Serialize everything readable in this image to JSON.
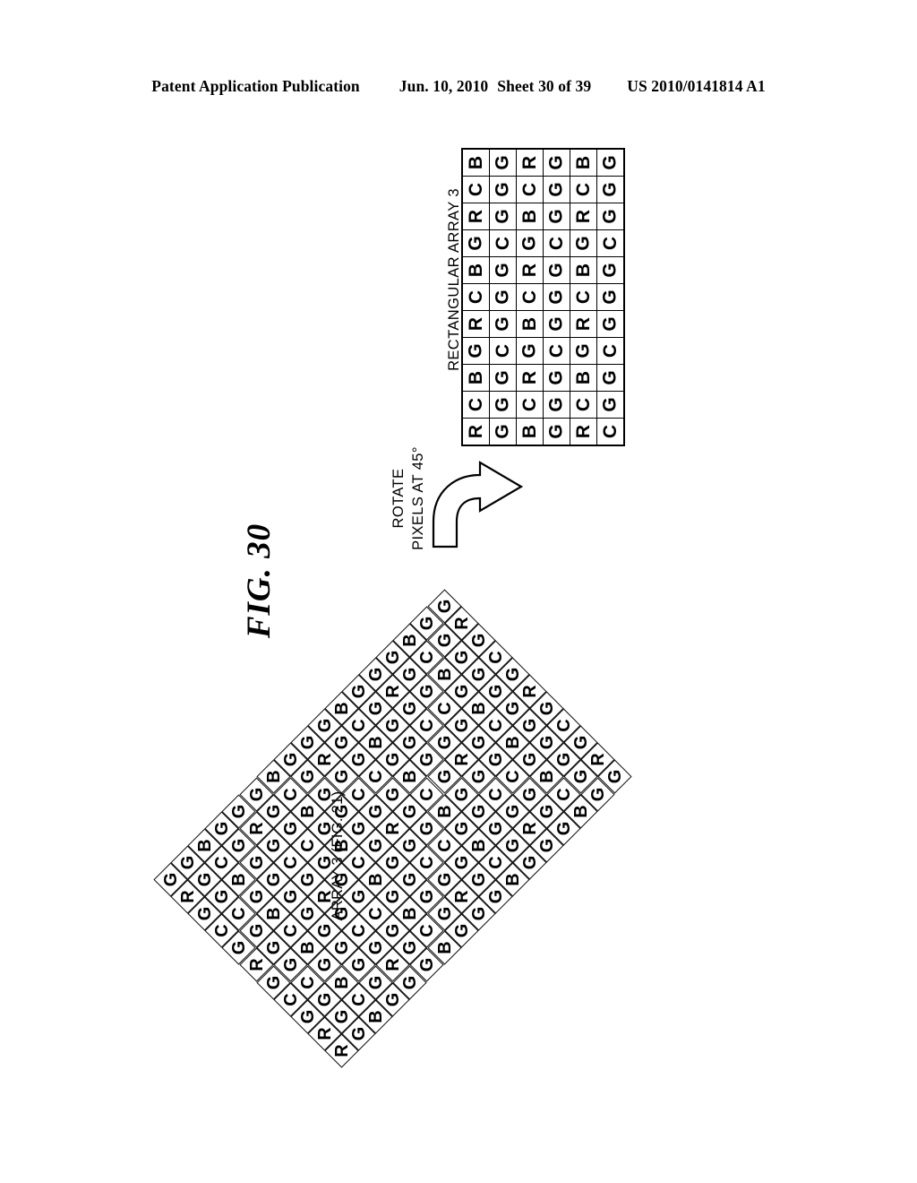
{
  "header": {
    "publication": "Patent Application Publication",
    "date": "Jun. 10, 2010",
    "sheet": "Sheet 30 of 39",
    "docnum": "US 2010/0141814 A1"
  },
  "figure": {
    "title": "FIG. 30"
  },
  "rotate_note": {
    "line1": "ROTATE",
    "line2": "PIXELS AT 45°",
    "arrow_icon": "curved-arrow-right-icon"
  },
  "rectangular_array": {
    "label": "RECTANGULAR ARRAY 3",
    "columns": 6,
    "rows": 11,
    "grid": [
      [
        "B",
        "G",
        "R",
        "G",
        "B",
        "G"
      ],
      [
        "C",
        "G",
        "C",
        "G",
        "C",
        "G"
      ],
      [
        "R",
        "G",
        "B",
        "G",
        "R",
        "G"
      ],
      [
        "G",
        "C",
        "G",
        "C",
        "G",
        "C"
      ],
      [
        "B",
        "G",
        "R",
        "G",
        "B",
        "G"
      ],
      [
        "C",
        "G",
        "C",
        "G",
        "C",
        "G"
      ],
      [
        "R",
        "G",
        "B",
        "G",
        "R",
        "G"
      ],
      [
        "G",
        "C",
        "G",
        "C",
        "G",
        "C"
      ],
      [
        "B",
        "G",
        "R",
        "G",
        "B",
        "G"
      ],
      [
        "C",
        "G",
        "C",
        "G",
        "C",
        "G"
      ],
      [
        "R",
        "G",
        "B",
        "G",
        "R",
        "C"
      ]
    ]
  },
  "diamond_array": {
    "label": "ARRAY 3 (FIG. 21)",
    "rotation_degrees": 45,
    "columns": 11,
    "rows": 17,
    "grid": [
      [
        "G",
        "R",
        "G",
        "C",
        "G",
        "R",
        "G",
        "C",
        "G",
        "R",
        "G"
      ],
      [
        "G",
        "G",
        "G",
        "G",
        "G",
        "G",
        "G",
        "G",
        "G",
        "G",
        "G"
      ],
      [
        "B",
        "C",
        "B",
        "G",
        "B",
        "C",
        "B",
        "G",
        "B",
        "C",
        "B"
      ],
      [
        "G",
        "G",
        "G",
        "C",
        "G",
        "G",
        "G",
        "C",
        "G",
        "G",
        "G"
      ],
      [
        "G",
        "R",
        "G",
        "C",
        "G",
        "R",
        "G",
        "C",
        "G",
        "R",
        "G"
      ],
      [
        "G",
        "G",
        "G",
        "G",
        "G",
        "G",
        "G",
        "G",
        "G",
        "G",
        "G"
      ],
      [
        "B",
        "C",
        "B",
        "G",
        "B",
        "C",
        "B",
        "G",
        "B",
        "C",
        "B"
      ],
      [
        "G",
        "G",
        "G",
        "C",
        "G",
        "G",
        "G",
        "C",
        "G",
        "G",
        "G"
      ],
      [
        "G",
        "R",
        "G",
        "C",
        "G",
        "R",
        "G",
        "C",
        "G",
        "R",
        "G"
      ],
      [
        "G",
        "G",
        "G",
        "G",
        "G",
        "G",
        "G",
        "G",
        "G",
        "G",
        "G"
      ],
      [
        "B",
        "C",
        "B",
        "G",
        "B",
        "C",
        "B",
        "G",
        "B",
        "C",
        "B"
      ],
      [
        "G",
        "G",
        "G",
        "C",
        "G",
        "G",
        "G",
        "C",
        "G",
        "G",
        "G"
      ],
      [
        "G",
        "R",
        "G",
        "C",
        "G",
        "R",
        "G",
        "C",
        "G",
        "R",
        "G"
      ],
      [
        "G",
        "G",
        "G",
        "G",
        "G",
        "G",
        "G",
        "G",
        "G",
        "G",
        "G"
      ],
      [
        "B",
        "C",
        "B",
        "G",
        "B",
        "C",
        "B",
        "G",
        "B",
        "C",
        "B"
      ],
      [
        "G",
        "G",
        "G",
        "C",
        "G",
        "G",
        "G",
        "C",
        "G",
        "G",
        "G"
      ],
      [
        "G",
        "R",
        "G",
        "C",
        "G",
        "R",
        "G",
        "C",
        "G",
        "R",
        "R"
      ]
    ]
  },
  "colors": {
    "ink": "#000000",
    "paper": "#ffffff"
  }
}
